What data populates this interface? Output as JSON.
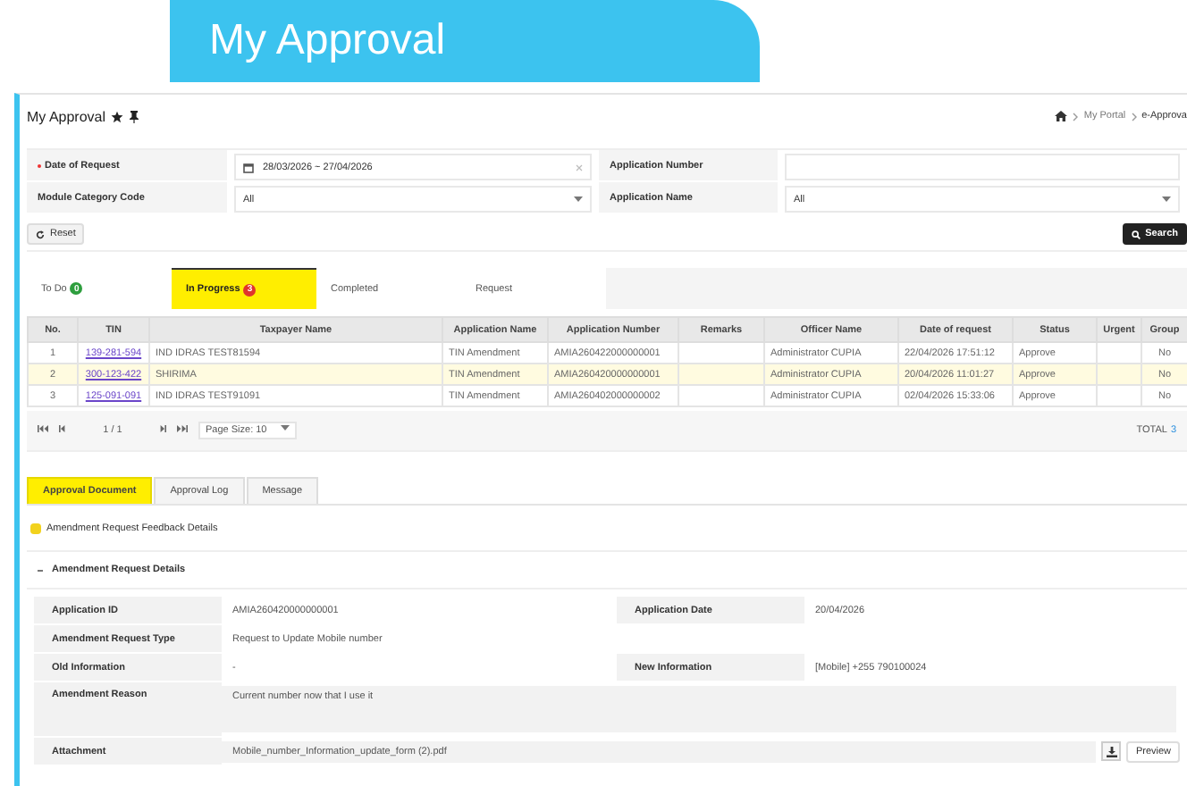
{
  "banner": {
    "title": "My Approval"
  },
  "header": {
    "title": "My Approval",
    "breadcrumb": [
      "My Portal",
      "e-Approva"
    ]
  },
  "filters": [
    {
      "label": "Date of Request",
      "required": true,
      "kind": "date",
      "value": "28/03/2026 ~ 27/04/2026"
    },
    {
      "label": "Application Number",
      "required": false,
      "kind": "text"
    },
    {
      "label": "Module Category Code",
      "required": false,
      "kind": "select",
      "value": "All"
    },
    {
      "label": "Application Name",
      "required": false,
      "kind": "select",
      "value": "All"
    }
  ],
  "reset_button": "Reset",
  "search_button": "Search",
  "tabs": [
    {
      "label": "To Do",
      "badge": "0",
      "color": "#2e9e3e",
      "selected": false
    },
    {
      "label": "In Progress",
      "badge": "3",
      "color": "#e0342c",
      "selected": true
    },
    {
      "label": "Completed",
      "selected": false
    },
    {
      "label": "Request",
      "selected": false
    }
  ],
  "table": {
    "columns": [
      "No.",
      "TIN",
      "Taxpayer Name",
      "Application Name",
      "Application Number",
      "Remarks",
      "Officer Name",
      "Date of request",
      "Status",
      "Urgent",
      "Group"
    ],
    "rows": [
      {
        "selected": false,
        "cells": [
          "1",
          "139-281-594",
          "IND IDRAS TEST81594",
          "TIN Amendment",
          "AMIA260422000000001",
          "",
          "Administrator CUPIA",
          "22/04/2026 17:51:12",
          "Approve",
          "",
          "No"
        ]
      },
      {
        "selected": true,
        "cells": [
          "2",
          "300-123-422",
          "SHIRIMA",
          "TIN Amendment",
          "AMIA260420000000001",
          "",
          "Administrator CUPIA",
          "20/04/2026 11:01:27",
          "Approve",
          "",
          "No"
        ]
      },
      {
        "selected": false,
        "cells": [
          "3",
          "125-091-091",
          "IND IDRAS TEST91091",
          "TIN Amendment",
          "AMIA260402000000002",
          "",
          "Administrator CUPIA",
          "02/04/2026 15:33:06",
          "Approve",
          "",
          "No"
        ]
      }
    ]
  },
  "pager": {
    "page": "1 / 1",
    "page_size": "Page Size: 10",
    "total_label": "TOTAL",
    "total": "3"
  },
  "detail_tabs": [
    {
      "label": "Approval Document",
      "selected": true
    },
    {
      "label": "Approval Log",
      "selected": false
    },
    {
      "label": "Message",
      "selected": false
    }
  ],
  "feedback_title": "Amendment Request Feedback Details",
  "details": {
    "title": "Amendment Request Details",
    "expanded": true,
    "rows": [
      {
        "kind": "pair",
        "label": "Application ID",
        "value": "AMIA260420000000001",
        "label2": "Application Date",
        "value2": "20/04/2026"
      },
      {
        "kind": "pair",
        "label": "Amendment Request Type",
        "value": "Request to Update Mobile number"
      },
      {
        "kind": "pair",
        "label": "Old Information",
        "value": "-",
        "label2": "New Information",
        "value2": "[Mobile] +255 790100024"
      },
      {
        "kind": "area",
        "label": "Amendment Reason",
        "value": "Current number now that I use it"
      },
      {
        "kind": "file",
        "label": "Attachment",
        "value": "Mobile_number_Information_update_form (2).pdf",
        "button": "Preview"
      }
    ]
  }
}
